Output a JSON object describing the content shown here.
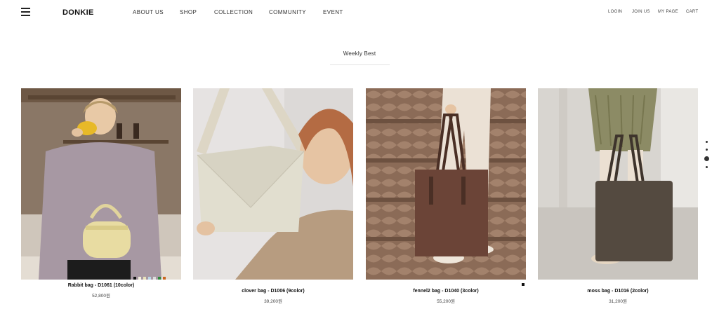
{
  "header": {
    "logo": "DONKIE",
    "nav": [
      "ABOUT US",
      "SHOP",
      "COLLECTION",
      "COMMUNITY",
      "EVENT"
    ],
    "utility": [
      "LOGIN",
      "JOIN US",
      "MY PAGE",
      "CART"
    ]
  },
  "section": {
    "title": "Weekly Best"
  },
  "products": [
    {
      "name": "Rabbit bag - D1061 (10color)",
      "price": "52,800원",
      "swatch_colors": [
        "#111111",
        "#f3eedc",
        "#e9e2ba",
        "#b9d5e6",
        "#dcdcdc",
        "#2f8a3c",
        "#c9661f"
      ]
    },
    {
      "name": "clover bag - D1006 (9color)",
      "price": "39,200원",
      "swatch_colors": []
    },
    {
      "name": "fennel2 bag - D1040 (3color)",
      "price": "55,200원",
      "swatch_colors": [
        "#111111"
      ]
    },
    {
      "name": "moss bag - D1016 (2color)",
      "price": "31,200원",
      "swatch_colors": []
    }
  ],
  "pager": {
    "count": 4,
    "active_index": 2
  }
}
